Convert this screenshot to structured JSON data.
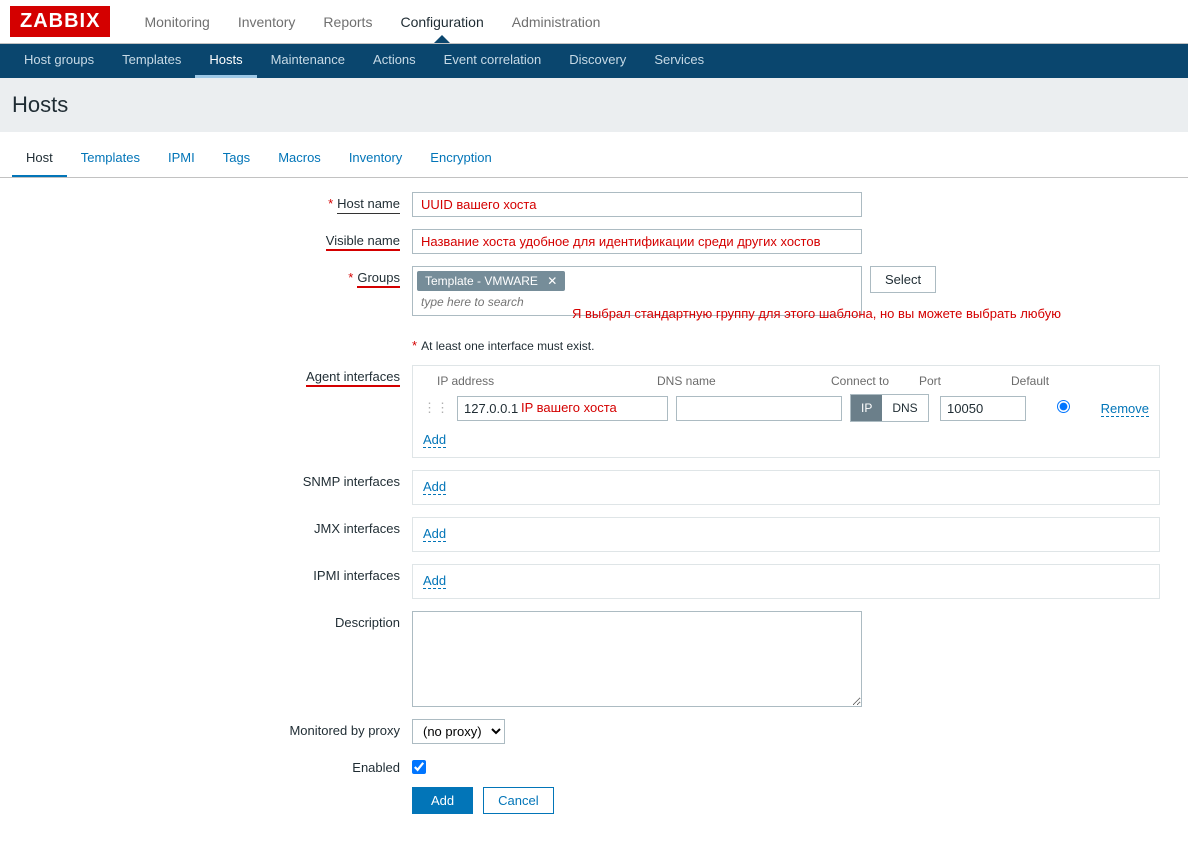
{
  "logo": "ZABBIX",
  "topnav": {
    "monitoring": "Monitoring",
    "inventory": "Inventory",
    "reports": "Reports",
    "configuration": "Configuration",
    "administration": "Administration"
  },
  "subnav": {
    "host_groups": "Host groups",
    "templates": "Templates",
    "hosts": "Hosts",
    "maintenance": "Maintenance",
    "actions": "Actions",
    "event_correlation": "Event correlation",
    "discovery": "Discovery",
    "services": "Services"
  },
  "page_title": "Hosts",
  "tabs": {
    "host": "Host",
    "templates": "Templates",
    "ipmi": "IPMI",
    "tags": "Tags",
    "macros": "Macros",
    "inventory": "Inventory",
    "encryption": "Encryption"
  },
  "labels": {
    "host_name": "Host name",
    "visible_name": "Visible name",
    "groups": "Groups",
    "agent_interfaces": "Agent interfaces",
    "snmp_interfaces": "SNMP interfaces",
    "jmx_interfaces": "JMX interfaces",
    "ipmi_interfaces": "IPMI interfaces",
    "description": "Description",
    "monitored_by_proxy": "Monitored by proxy",
    "enabled": "Enabled"
  },
  "fields": {
    "host_name_value": "UUID вашего хоста",
    "visible_name_value": "Название хоста удобное для идентификации среди других хостов",
    "group_tag": "Template - VMWARE",
    "group_tag_x": "✕",
    "group_search_placeholder": "type here to search",
    "select_button": "Select",
    "interface_note": "At least one interface must exist.",
    "groups_annotation": "Я выбрал стандартную группу для этого шаблона, но вы можете выбрать любую",
    "proxy_value": "(no proxy)",
    "enabled_checked": true
  },
  "interface": {
    "headers": {
      "ip": "IP address",
      "dns": "DNS name",
      "connect": "Connect to",
      "port": "Port",
      "default": "Default"
    },
    "row": {
      "ip": "127.0.0.1",
      "ip_overlay": "IP вашего хоста",
      "dns": "",
      "connect_ip": "IP",
      "connect_dns": "DNS",
      "port": "10050",
      "remove": "Remove"
    },
    "add": "Add"
  },
  "buttons": {
    "add": "Add",
    "cancel": "Cancel"
  }
}
